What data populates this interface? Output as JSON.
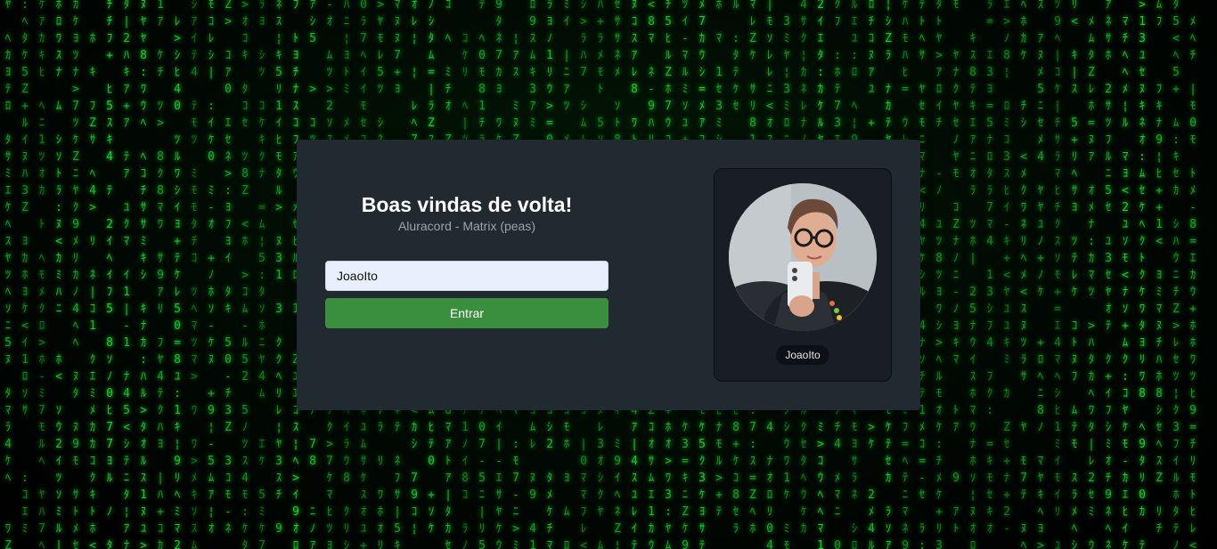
{
  "login": {
    "title": "Boas vindas de volta!",
    "subtitle": "Aluracord - Matrix (peas)",
    "username_value": "JoaoIto",
    "submit_label": "Entrar"
  },
  "profile": {
    "username": "JoaoIto",
    "avatar_description_icon": "user-photo"
  },
  "colors": {
    "card_bg": "#212931",
    "button": "#3a8f3f",
    "matrix_green": "#1fd13a",
    "input_bg": "#e8f0fe"
  }
}
